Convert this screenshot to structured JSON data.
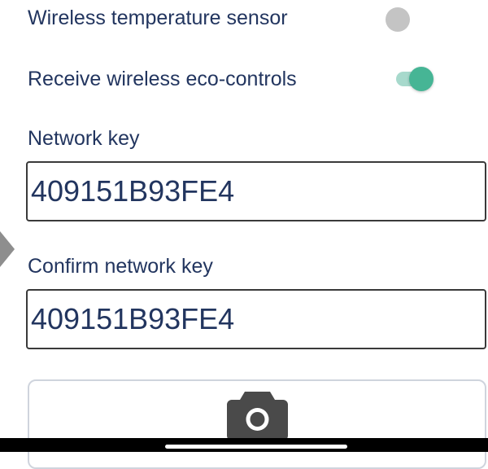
{
  "settings": {
    "wireless_temp_sensor": {
      "label": "Wireless temperature sensor",
      "enabled": false
    },
    "receive_eco_controls": {
      "label": "Receive wireless eco-controls",
      "enabled": true
    }
  },
  "network_key": {
    "label": "Network key",
    "value": "409151B93FE4"
  },
  "confirm_network_key": {
    "label": "Confirm network key",
    "value": "409151B93FE4"
  },
  "scan_button": {
    "icon": "camera-icon"
  },
  "colors": {
    "text": "#22355f",
    "toggle_on": "#46b595",
    "toggle_off": "#c4c4c4"
  }
}
